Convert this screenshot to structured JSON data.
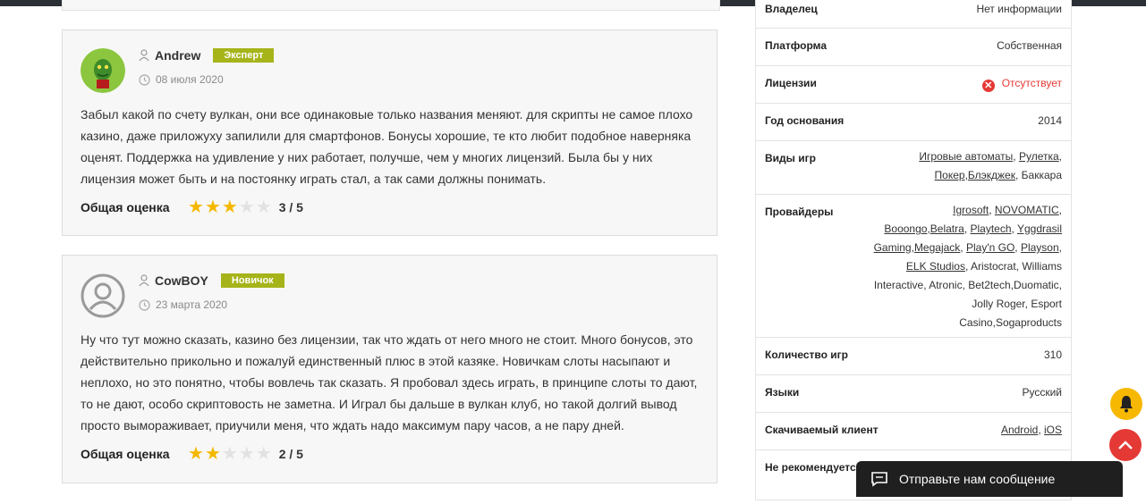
{
  "reviews": [
    {
      "name": "Andrew",
      "badge": "Эксперт",
      "date": "08 июля 2020",
      "text": "Забыл какой по счету вулкан, они все одинаковые только названия меняют. для скрипты не самое плохо казино, даже приложуху запилили для смартфонов. Бонусы хорошие, те кто любит подобное наверняка оценят. Поддержка на удивление у них работает, получше, чем у многих лицензий. Была бы у них лицензия может быть и на постоянку играть стал, а так сами должны понимать.",
      "rating_label": "Общая оценка",
      "rating": 3,
      "rating_text": "3 / 5",
      "avatar_icon": "grinch-avatar-icon"
    },
    {
      "name": "CowBOY",
      "badge": "Новичок",
      "date": "23 марта 2020",
      "text": "Ну что тут можно сказать, казино без лицензии, так что ждать от него много не стоит. Много бонусов, это действительно прикольно и пожалуй единственный плюс в этой казяке. Новичкам слоты насыпают и неплохо, но это понятно, чтобы вовлечь так сказать. Я пробовал здесь играть, в принципе слоты то дают, то не дают, особо скриптовость не заметна. И Играл бы дальше в вулкан клуб, но такой долгий вывод просто вымораживает, приучили меня, что ждать надо максимум пару часов, а не пару дней.",
      "rating_label": "Общая оценка",
      "rating": 2,
      "rating_text": "2 / 5",
      "avatar_icon": "default-user-avatar-icon"
    }
  ],
  "info": {
    "owner": {
      "label": "Владелец",
      "value": "Нет информации"
    },
    "platform": {
      "label": "Платформа",
      "value": "Собственная"
    },
    "licenses": {
      "label": "Лицензии",
      "value": "Отсутствует",
      "icon": "error-x-icon"
    },
    "founded": {
      "label": "Год основания",
      "value": "2014"
    },
    "game_types": {
      "label": "Виды игр",
      "items": [
        {
          "text": "Игровые автоматы",
          "link": true,
          "sep": ", "
        },
        {
          "text": "Рулетка",
          "link": true,
          "sep": ", "
        },
        {
          "text": "Покер",
          "link": true,
          "sep": ","
        },
        {
          "text": "Блэкджек",
          "link": true,
          "sep": ", "
        },
        {
          "text": "Баккара",
          "link": false,
          "sep": ""
        }
      ]
    },
    "providers": {
      "label": "Провайдеры",
      "items": [
        {
          "text": "Igrosoft",
          "link": true,
          "sep": ", "
        },
        {
          "text": "NOVOMATIC",
          "link": true,
          "sep": ", "
        },
        {
          "text": "Booongo",
          "link": true,
          "sep": ","
        },
        {
          "text": "Belatra",
          "link": true,
          "sep": ", "
        },
        {
          "text": "Playtech",
          "link": true,
          "sep": ", "
        },
        {
          "text": "Yggdrasil Gaming",
          "link": true,
          "sep": ","
        },
        {
          "text": "Megajack",
          "link": true,
          "sep": ", "
        },
        {
          "text": "Play'n GO",
          "link": true,
          "sep": ", "
        },
        {
          "text": "Playson",
          "link": true,
          "sep": ", "
        },
        {
          "text": "ELK Studios",
          "link": true,
          "sep": ", "
        },
        {
          "text": "Aristocrat",
          "link": false,
          "sep": ", "
        },
        {
          "text": "Williams Interactive",
          "link": false,
          "sep": ", "
        },
        {
          "text": "Atronic",
          "link": false,
          "sep": ", "
        },
        {
          "text": "Bet2tech",
          "link": false,
          "sep": ","
        },
        {
          "text": "Duomatic",
          "link": false,
          "sep": ", "
        },
        {
          "text": "Jolly Roger",
          "link": false,
          "sep": ", "
        },
        {
          "text": "Esport Casino",
          "link": false,
          "sep": ","
        },
        {
          "text": "Sogaproducts",
          "link": false,
          "sep": ""
        }
      ]
    },
    "games_count": {
      "label": "Количество игр",
      "value": "310"
    },
    "languages": {
      "label": "Языки",
      "value": "Русский"
    },
    "client": {
      "label": "Скачиваемый клиент",
      "items": [
        {
          "text": "Android",
          "link": true,
          "sep": ", "
        },
        {
          "text": "iOS",
          "link": true,
          "sep": ""
        }
      ]
    },
    "not_recommended": {
      "label": "Не рекомендуется"
    }
  },
  "floating": {
    "bell_icon": "bell-icon",
    "up_icon": "arrow-up-icon",
    "chat_label": "Отправьте нам сообщение",
    "chat_icon": "chat-message-icon"
  },
  "colors": {
    "badge": "#a6b41a",
    "star": "#f5b800",
    "error": "#e53935",
    "bell": "#f6b800"
  }
}
